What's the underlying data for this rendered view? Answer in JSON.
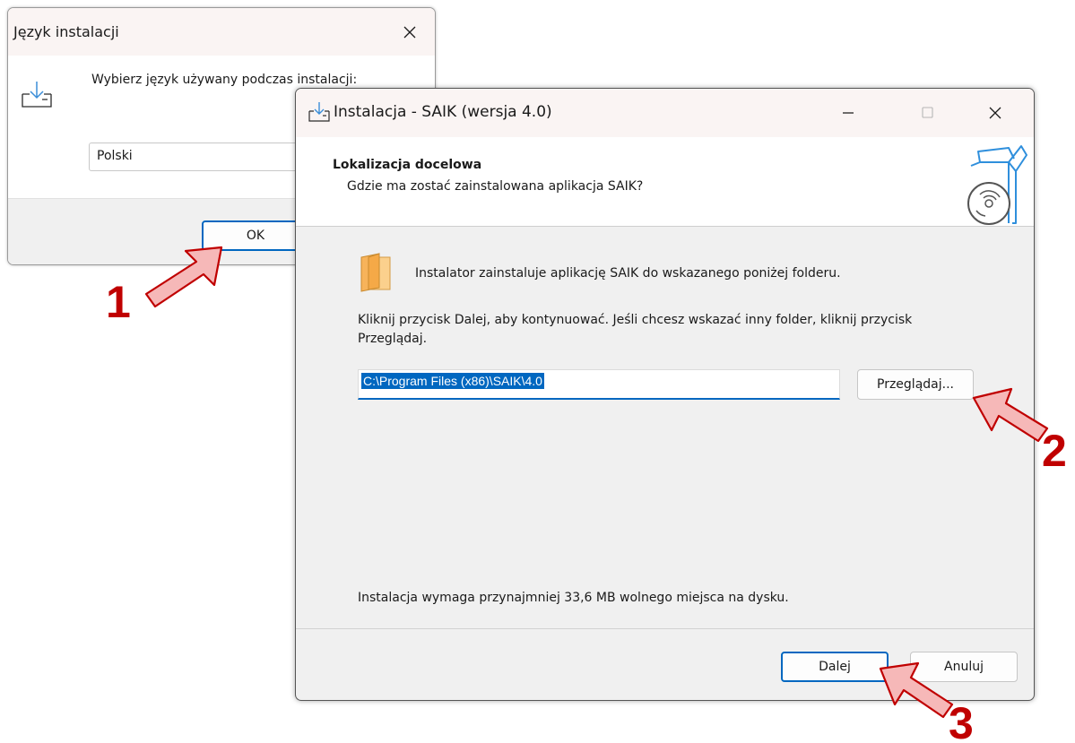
{
  "lang_dialog": {
    "title": "Język instalacji",
    "prompt": "Wybierz język używany podczas instalacji:",
    "selected_language": "Polski",
    "ok_label": "OK"
  },
  "installer": {
    "title": "Instalacja - SAIK (wersja 4.0)",
    "heading": "Lokalizacja docelowa",
    "subheading": "Gdzie ma zostać zainstalowana aplikacja SAIK?",
    "info_line": "Instalator zainstaluje aplikację SAIK do wskazanego poniżej folderu.",
    "instructions": "Kliknij przycisk Dalej, aby kontynuować. Jeśli chcesz wskazać inny folder, kliknij przycisk Przeglądaj.",
    "install_path": "C:\\Program Files (x86)\\SAIK\\4.0",
    "browse_label": "Przeglądaj...",
    "space_required": "Instalacja wymaga przynajmniej 33,6 MB wolnego miejsca na dysku.",
    "next_label": "Dalej",
    "cancel_label": "Anuluj"
  },
  "annotations": {
    "step_1": "1",
    "step_2": "2",
    "step_3": "3",
    "arrow_color": "#c00000",
    "arrow_fill": "#f6b8b8"
  },
  "colors": {
    "accent": "#0067c0",
    "titlebar": "#faf4f3"
  }
}
